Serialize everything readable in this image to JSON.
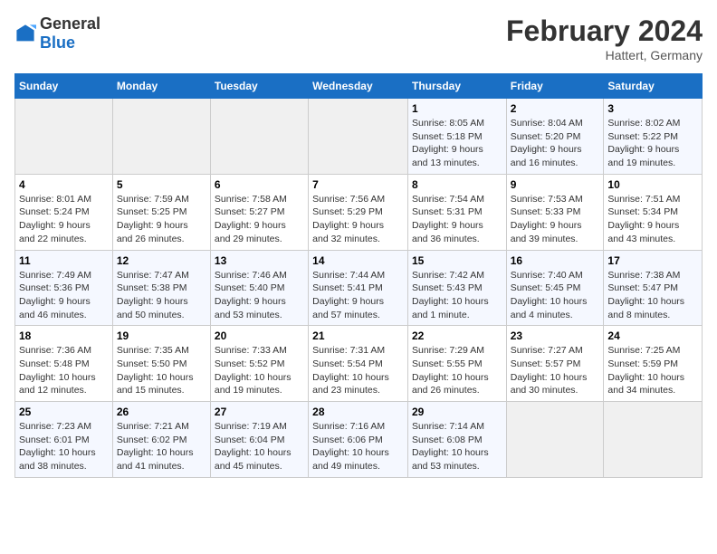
{
  "logo": {
    "general": "General",
    "blue": "Blue"
  },
  "header": {
    "month_year": "February 2024",
    "location": "Hattert, Germany"
  },
  "weekdays": [
    "Sunday",
    "Monday",
    "Tuesday",
    "Wednesday",
    "Thursday",
    "Friday",
    "Saturday"
  ],
  "weeks": [
    [
      {
        "day": "",
        "content": ""
      },
      {
        "day": "",
        "content": ""
      },
      {
        "day": "",
        "content": ""
      },
      {
        "day": "",
        "content": ""
      },
      {
        "day": "1",
        "content": "Sunrise: 8:05 AM\nSunset: 5:18 PM\nDaylight: 9 hours\nand 13 minutes."
      },
      {
        "day": "2",
        "content": "Sunrise: 8:04 AM\nSunset: 5:20 PM\nDaylight: 9 hours\nand 16 minutes."
      },
      {
        "day": "3",
        "content": "Sunrise: 8:02 AM\nSunset: 5:22 PM\nDaylight: 9 hours\nand 19 minutes."
      }
    ],
    [
      {
        "day": "4",
        "content": "Sunrise: 8:01 AM\nSunset: 5:24 PM\nDaylight: 9 hours\nand 22 minutes."
      },
      {
        "day": "5",
        "content": "Sunrise: 7:59 AM\nSunset: 5:25 PM\nDaylight: 9 hours\nand 26 minutes."
      },
      {
        "day": "6",
        "content": "Sunrise: 7:58 AM\nSunset: 5:27 PM\nDaylight: 9 hours\nand 29 minutes."
      },
      {
        "day": "7",
        "content": "Sunrise: 7:56 AM\nSunset: 5:29 PM\nDaylight: 9 hours\nand 32 minutes."
      },
      {
        "day": "8",
        "content": "Sunrise: 7:54 AM\nSunset: 5:31 PM\nDaylight: 9 hours\nand 36 minutes."
      },
      {
        "day": "9",
        "content": "Sunrise: 7:53 AM\nSunset: 5:33 PM\nDaylight: 9 hours\nand 39 minutes."
      },
      {
        "day": "10",
        "content": "Sunrise: 7:51 AM\nSunset: 5:34 PM\nDaylight: 9 hours\nand 43 minutes."
      }
    ],
    [
      {
        "day": "11",
        "content": "Sunrise: 7:49 AM\nSunset: 5:36 PM\nDaylight: 9 hours\nand 46 minutes."
      },
      {
        "day": "12",
        "content": "Sunrise: 7:47 AM\nSunset: 5:38 PM\nDaylight: 9 hours\nand 50 minutes."
      },
      {
        "day": "13",
        "content": "Sunrise: 7:46 AM\nSunset: 5:40 PM\nDaylight: 9 hours\nand 53 minutes."
      },
      {
        "day": "14",
        "content": "Sunrise: 7:44 AM\nSunset: 5:41 PM\nDaylight: 9 hours\nand 57 minutes."
      },
      {
        "day": "15",
        "content": "Sunrise: 7:42 AM\nSunset: 5:43 PM\nDaylight: 10 hours\nand 1 minute."
      },
      {
        "day": "16",
        "content": "Sunrise: 7:40 AM\nSunset: 5:45 PM\nDaylight: 10 hours\nand 4 minutes."
      },
      {
        "day": "17",
        "content": "Sunrise: 7:38 AM\nSunset: 5:47 PM\nDaylight: 10 hours\nand 8 minutes."
      }
    ],
    [
      {
        "day": "18",
        "content": "Sunrise: 7:36 AM\nSunset: 5:48 PM\nDaylight: 10 hours\nand 12 minutes."
      },
      {
        "day": "19",
        "content": "Sunrise: 7:35 AM\nSunset: 5:50 PM\nDaylight: 10 hours\nand 15 minutes."
      },
      {
        "day": "20",
        "content": "Sunrise: 7:33 AM\nSunset: 5:52 PM\nDaylight: 10 hours\nand 19 minutes."
      },
      {
        "day": "21",
        "content": "Sunrise: 7:31 AM\nSunset: 5:54 PM\nDaylight: 10 hours\nand 23 minutes."
      },
      {
        "day": "22",
        "content": "Sunrise: 7:29 AM\nSunset: 5:55 PM\nDaylight: 10 hours\nand 26 minutes."
      },
      {
        "day": "23",
        "content": "Sunrise: 7:27 AM\nSunset: 5:57 PM\nDaylight: 10 hours\nand 30 minutes."
      },
      {
        "day": "24",
        "content": "Sunrise: 7:25 AM\nSunset: 5:59 PM\nDaylight: 10 hours\nand 34 minutes."
      }
    ],
    [
      {
        "day": "25",
        "content": "Sunrise: 7:23 AM\nSunset: 6:01 PM\nDaylight: 10 hours\nand 38 minutes."
      },
      {
        "day": "26",
        "content": "Sunrise: 7:21 AM\nSunset: 6:02 PM\nDaylight: 10 hours\nand 41 minutes."
      },
      {
        "day": "27",
        "content": "Sunrise: 7:19 AM\nSunset: 6:04 PM\nDaylight: 10 hours\nand 45 minutes."
      },
      {
        "day": "28",
        "content": "Sunrise: 7:16 AM\nSunset: 6:06 PM\nDaylight: 10 hours\nand 49 minutes."
      },
      {
        "day": "29",
        "content": "Sunrise: 7:14 AM\nSunset: 6:08 PM\nDaylight: 10 hours\nand 53 minutes."
      },
      {
        "day": "",
        "content": ""
      },
      {
        "day": "",
        "content": ""
      }
    ]
  ]
}
